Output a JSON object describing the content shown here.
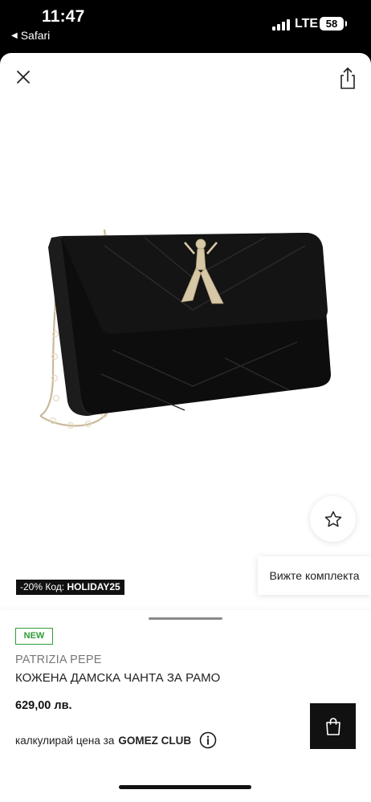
{
  "status_bar": {
    "time": "11:47",
    "back_app": "Safari",
    "network": "LTE",
    "battery": "58"
  },
  "header": {
    "close_icon": "close-icon",
    "share_icon": "share-icon"
  },
  "product_image": {
    "icon": "handbag-image"
  },
  "favorite": {
    "icon": "star-outline-icon"
  },
  "promo": {
    "prefix": "-20% Код:",
    "code": "HOLIDAY25"
  },
  "bundle_button": {
    "label": "Вижте комплекта"
  },
  "details": {
    "badge": "NEW",
    "brand": "PATRIZIA PEPE",
    "title": "КОЖЕНА ДАМСКА ЧАНТА ЗА РАМО",
    "price": "629,00 лв.",
    "club_text": "калкулирай цена за",
    "club_name": "GOMEZ CLUB",
    "info_icon": "info-icon",
    "cart_icon": "shopping-bag-icon"
  },
  "colors": {
    "badge_green": "#2e9b3b",
    "dark": "#111111",
    "muted": "#777777"
  }
}
